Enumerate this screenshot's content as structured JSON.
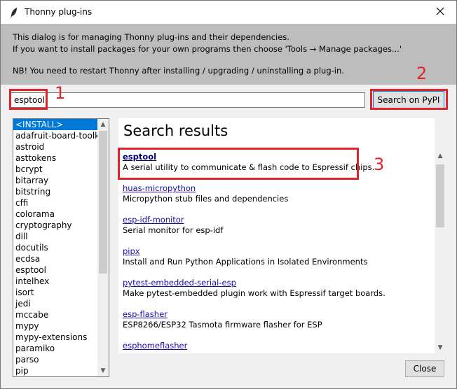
{
  "window": {
    "title": "Thonny plug-ins"
  },
  "info": {
    "line1": "This dialog is for managing Thonny plug-ins and their dependencies.",
    "line2": "If you want to install packages for your own programs then choose 'Tools → Manage packages...'",
    "line3": "NB! You need to restart Thonny after installing / upgrading / uninstalling a plug-in."
  },
  "search": {
    "value": "esptool",
    "button_label": "Search on PyPI"
  },
  "plugins": {
    "items": [
      "<INSTALL>",
      "adafruit-board-toolkit",
      "astroid",
      "asttokens",
      "bcrypt",
      "bitarray",
      "bitstring",
      "cffi",
      "colorama",
      "cryptography",
      "dill",
      "docutils",
      "ecdsa",
      "esptool",
      "intelhex",
      "isort",
      "jedi",
      "mccabe",
      "mypy",
      "mypy-extensions",
      "paramiko",
      "parso",
      "pip"
    ],
    "selected": "<INSTALL>"
  },
  "results": {
    "title": "Search results",
    "items": [
      {
        "name": "esptool",
        "description": "A serial utility to communicate & flash code to Espressif chips."
      },
      {
        "name": "huas-micropython",
        "description": "Micropython stub files and dependencies"
      },
      {
        "name": "esp-idf-monitor",
        "description": "Serial monitor for esp-idf"
      },
      {
        "name": "pipx",
        "description": "Install and Run Python Applications in Isolated Environments"
      },
      {
        "name": "pytest-embedded-serial-esp",
        "description": "Make pytest-embedded plugin work with Espressif target boards."
      },
      {
        "name": "esp-flasher",
        "description": "ESP8266/ESP32 Tasmota firmware flasher for ESP"
      },
      {
        "name": "esphomeflasher",
        "description": ""
      }
    ]
  },
  "footer": {
    "close_label": "Close"
  },
  "annotations": {
    "n1": "1",
    "n2": "2",
    "n3": "3",
    "color": "#e0242c"
  },
  "colors": {
    "selection": "#0078d7",
    "info_bg": "#bdbdbd",
    "link": "#1a0dab"
  }
}
